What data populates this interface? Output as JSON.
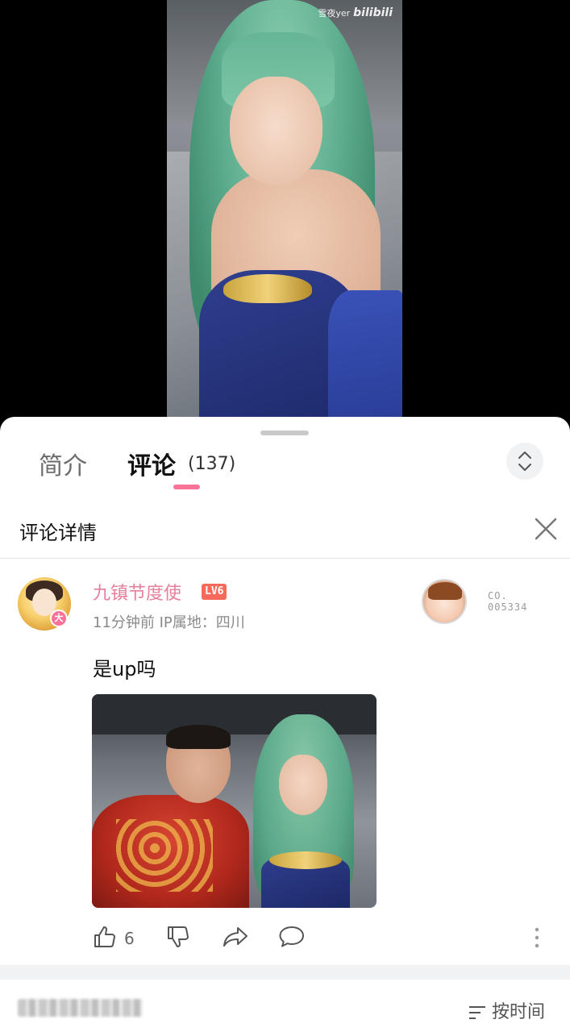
{
  "video": {
    "watermark_user": "雪夜yer",
    "watermark_brand": "bilibili"
  },
  "tabs": {
    "intro": "简介",
    "comments": "评论",
    "comment_count": "(137)"
  },
  "detail": {
    "title": "评论详情"
  },
  "comment": {
    "username": "九镇节度使",
    "level": "LV6",
    "avatar_badge": "大",
    "meta": "11分钟前 IP属地：四川",
    "text": "是up吗",
    "fan_badge_line1": "CO.",
    "fan_badge_line2": "005334",
    "like_count": "6"
  },
  "sort": {
    "label": "按时间"
  },
  "colors": {
    "accent_pink": "#fb7299",
    "username_pink": "#e67f9c",
    "level_badge": "#f76a5b"
  }
}
